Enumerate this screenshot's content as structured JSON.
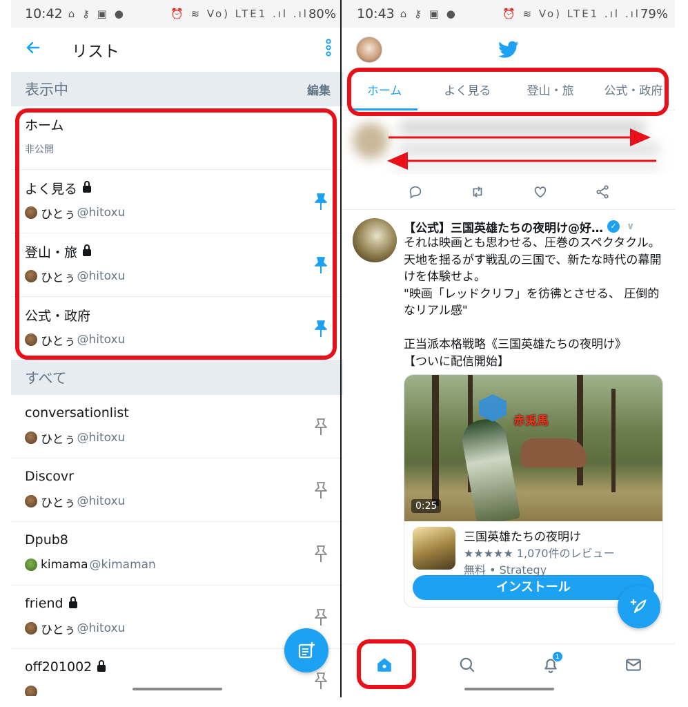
{
  "left": {
    "status": {
      "time": "10:42",
      "icons": "⌂ ⚷ ▣ ●",
      "right_icons": "⏰ ≋ Vo) LTE1 .ıl .ıl",
      "battery": "80%"
    },
    "appbar": {
      "back_icon": "arrow-left-icon",
      "title": "リスト",
      "menu_icon": "more-vert-icon"
    },
    "pinned_section": {
      "label": "表示中",
      "edit": "編集"
    },
    "pinned": [
      {
        "name": "ホーム",
        "sub": "非公開",
        "locked": false,
        "pinned": false
      },
      {
        "name": "よく見る",
        "owner": "ひとぅ",
        "handle": "@hitoxu",
        "locked": true,
        "pinned": true
      },
      {
        "name": "登山・旅",
        "owner": "ひとぅ",
        "handle": "@hitoxu",
        "locked": true,
        "pinned": true
      },
      {
        "name": "公式・政府",
        "owner": "ひとぅ",
        "handle": "@hitoxu",
        "locked": false,
        "pinned": true
      }
    ],
    "all_section": {
      "label": "すべて"
    },
    "all": [
      {
        "name": "conversationlist",
        "owner": "ひとぅ",
        "handle": "@hitoxu",
        "locked": false
      },
      {
        "name": "Discovr",
        "owner": "ひとぅ",
        "handle": "@hitoxu",
        "locked": false
      },
      {
        "name": "Dpub8",
        "owner": "kimama",
        "handle": "@kimaman",
        "locked": false
      },
      {
        "name": "friend",
        "owner": "ひとぅ",
        "handle": "@hitoxu",
        "locked": true
      },
      {
        "name": "off201002",
        "owner": "",
        "handle": "",
        "locked": true
      }
    ]
  },
  "right": {
    "status": {
      "time": "10:43",
      "icons": "⌂ ⚷ ▣ ●",
      "right_icons": "⏰ ≋ Vo) LTE1 .ıl .ıl",
      "battery": "79%"
    },
    "tabs": [
      "ホーム",
      "よく見る",
      "登山・旅",
      "公式・政府"
    ],
    "tweet": {
      "author": "【公式】三国英雄たちの夜明け@好…",
      "body": "それは映画とも思わせる、圧巻のスペクタクル。\n天地を揺るがす戦乱の三国で、新たな時代の幕開けを体験せよ。\n\"映画「レッドクリフ」を彷彿とさせる、 圧倒的なリアル感\"\n\n正当派本格戦略《三国英雄たちの夜明け》\n【ついに配信開始】",
      "video_duration": "0:25",
      "video_overlay_text": "赤兎馬",
      "app_name": "三国英雄たちの夜明け",
      "rating": "★★★★★ 1,070件のレビュー",
      "category": "無料 • Strategy",
      "install": "インストール"
    },
    "nav_badge": "1"
  },
  "colors": {
    "accent": "#1da1f2",
    "highlight": "#e8111a",
    "section_bg": "#e6ecf0",
    "muted": "#657786"
  }
}
